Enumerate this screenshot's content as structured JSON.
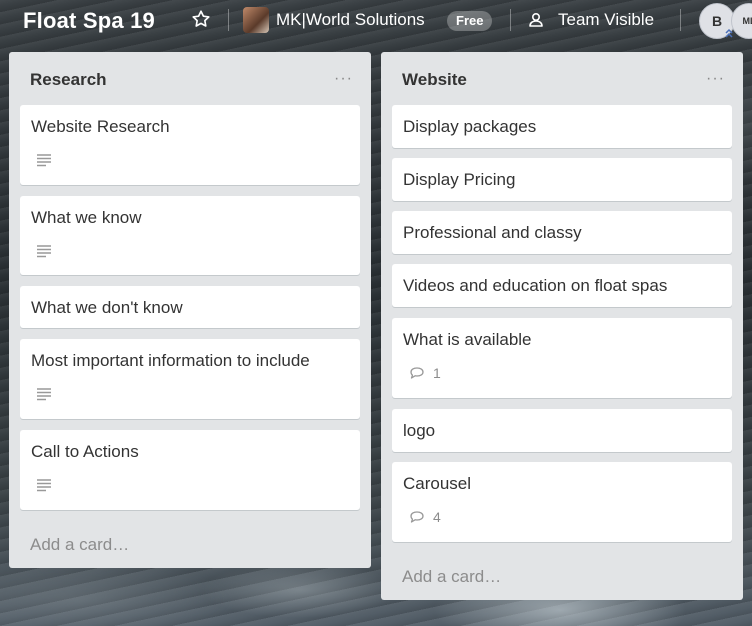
{
  "header": {
    "board_title": "Float Spa 19",
    "team_name": "MK|World Solutions",
    "plan_badge": "Free",
    "visibility": "Team Visible",
    "avatars": [
      "B",
      "ML"
    ]
  },
  "lists": [
    {
      "title": "Research",
      "menu": "···",
      "cards": [
        {
          "title": "Website Research",
          "has_description": true
        },
        {
          "title": "What we know",
          "has_description": true
        },
        {
          "title": "What we don't know",
          "has_description": false
        },
        {
          "title": "Most important information to include",
          "has_description": true
        },
        {
          "title": "Call to Actions",
          "has_description": true
        }
      ],
      "add_card": "Add a card…"
    },
    {
      "title": "Website",
      "menu": "···",
      "cards": [
        {
          "title": "Display packages"
        },
        {
          "title": "Display Pricing"
        },
        {
          "title": "Professional and classy"
        },
        {
          "title": "Videos and education on float spas"
        },
        {
          "title": "What is available",
          "comments": "1"
        },
        {
          "title": "logo"
        },
        {
          "title": "Carousel",
          "comments": "4"
        }
      ],
      "add_card": "Add a card…"
    }
  ]
}
